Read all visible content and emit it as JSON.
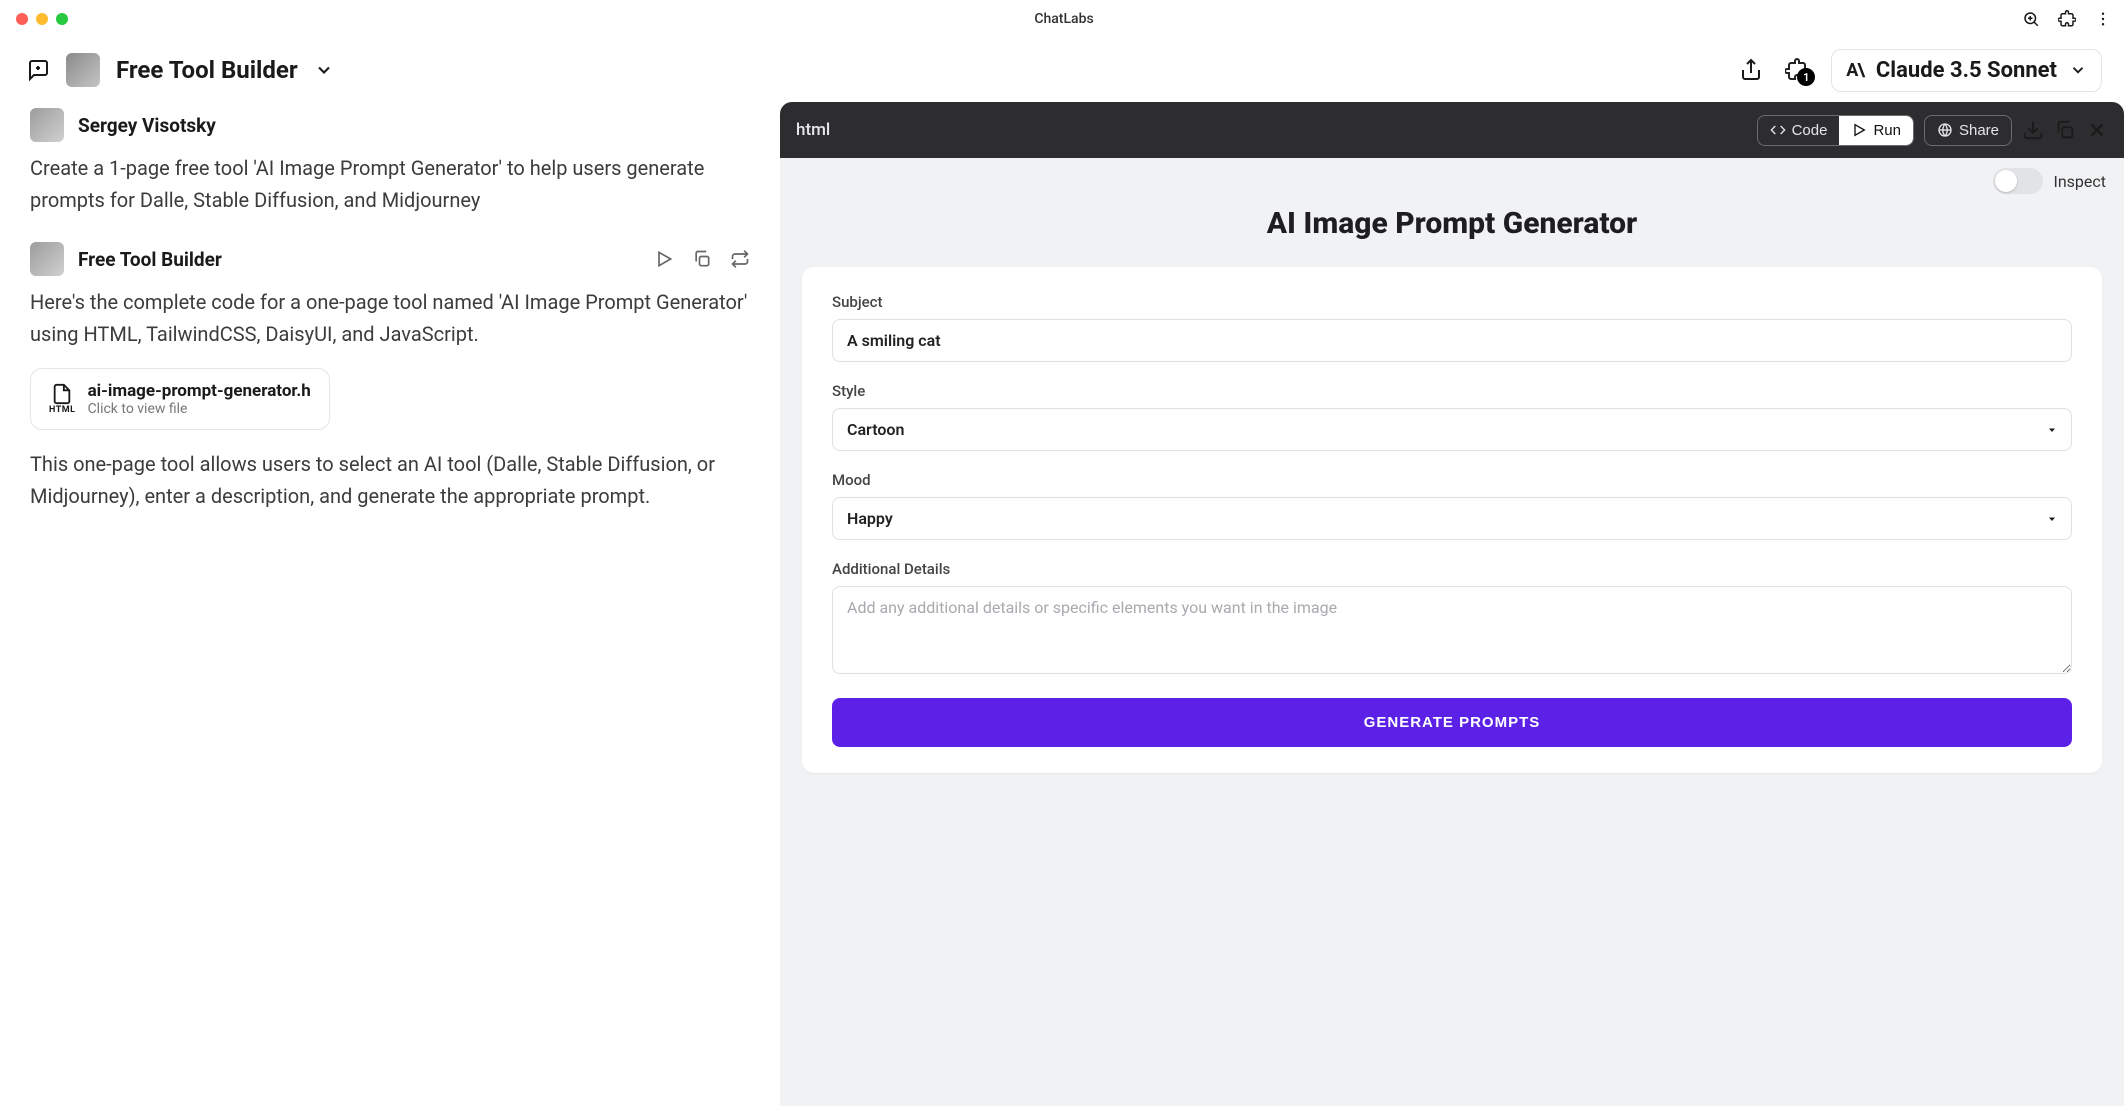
{
  "app": {
    "title": "ChatLabs"
  },
  "header": {
    "workspace": "Free Tool Builder",
    "ext_badge": "1",
    "model": "Claude 3.5 Sonnet",
    "model_logo": "A\\"
  },
  "chat": {
    "user": {
      "name": "Sergey Visotsky",
      "text": "Create a 1-page free tool 'AI Image Prompt Generator' to help users generate prompts for Dalle, Stable Diffusion, and Midjourney"
    },
    "assistant": {
      "name": "Free Tool Builder",
      "intro": "Here's the complete code for a one-page tool named 'AI Image Prompt Generator' using HTML, TailwindCSS, DaisyUI, and JavaScript.",
      "file": {
        "name": "ai-image-prompt-generator.h",
        "hint": "Click to view file",
        "badge": "HTML"
      },
      "outro": "This one-page tool allows users to select an AI tool (Dalle, Stable Diffusion, or Midjourney), enter a description, and generate the appropriate prompt."
    }
  },
  "panel": {
    "tab": "html",
    "code_label": "Code",
    "run_label": "Run",
    "share_label": "Share",
    "inspect_label": "Inspect"
  },
  "tool": {
    "title": "AI Image Prompt Generator",
    "subject": {
      "label": "Subject",
      "value": "A smiling cat"
    },
    "style": {
      "label": "Style",
      "value": "Cartoon"
    },
    "mood": {
      "label": "Mood",
      "value": "Happy"
    },
    "details": {
      "label": "Additional Details",
      "placeholder": "Add any additional details or specific elements you want in the image"
    },
    "button": "GENERATE PROMPTS"
  }
}
